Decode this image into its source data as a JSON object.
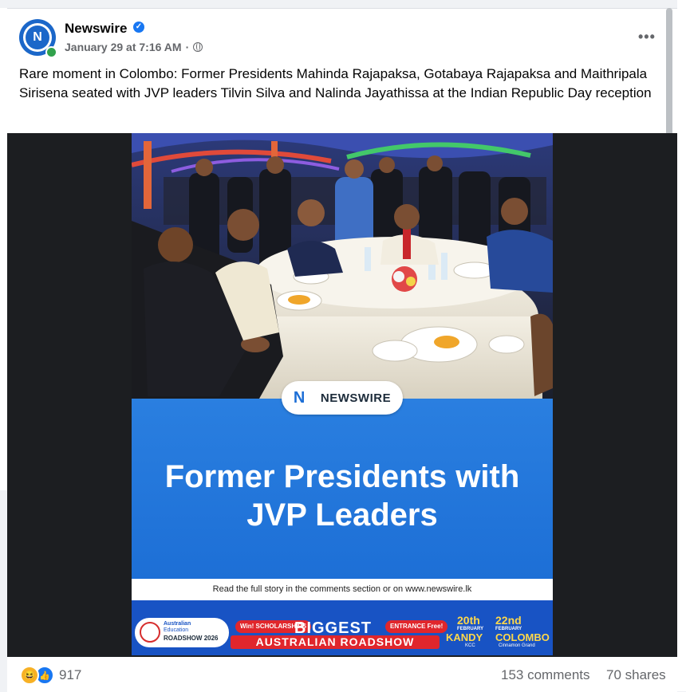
{
  "post": {
    "page_name": "Newswire",
    "timestamp": "January 29 at 7:16 AM",
    "separator": "·",
    "more_label": "•••",
    "text": "Rare moment in Colombo: Former Presidents Mahinda Rajapaksa, Gotabaya Rajapaksa and Maithripala Sirisena seated with JVP leaders Tilvin Silva and Nalinda Jayathissa at the Indian Republic Day reception",
    "icons": {
      "avatar": "newswire-logo",
      "verified": "verified-badge-icon",
      "audience": "globe-icon",
      "more": "more-options-icon"
    },
    "accent_color": "#1877f2"
  },
  "media": {
    "brand_label": "NEWSWIRE",
    "headline_line1": "Former Presidents with",
    "headline_line2": "JVP Leaders",
    "read_more": "Read the full story in the comments section or on www.newswire.lk",
    "panel_color": "#1d6fd6"
  },
  "ad_banner": {
    "org_line1": "Australian",
    "org_line2": "Education",
    "org_line3": "ROADSHOW",
    "year": "2026",
    "win_label": "Win! SCHOLARSHIPS",
    "headline": "BIGGEST",
    "entrance_label": "ENTRANCE Free!",
    "subheadline": "AUSTRALIAN ROADSHOW",
    "date1_day": "20th",
    "date1_month": "FEBRUARY",
    "date1_city": "KANDY",
    "date1_venue": "KCC",
    "date2_day": "22nd",
    "date2_month": "FEBRUARY",
    "date2_city": "COLOMBO",
    "date2_venue": "Cinnamon Grand"
  },
  "footer": {
    "reaction_count": "917",
    "comments": "153 comments",
    "shares": "70 shares",
    "reactions": [
      "haha-reaction-icon",
      "like-reaction-icon"
    ]
  }
}
